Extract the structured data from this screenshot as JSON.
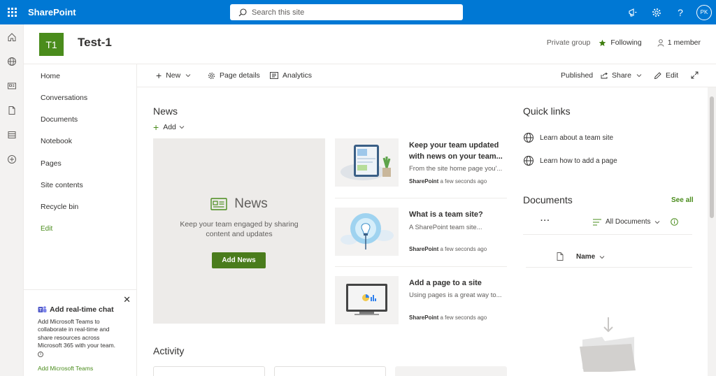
{
  "suite": {
    "app_name": "SharePoint",
    "search_placeholder": "Search this site",
    "avatar_initials": "PK"
  },
  "site": {
    "logo_text": "T1",
    "title": "Test-1",
    "privacy": "Private group",
    "following": "Following",
    "members": "1 member"
  },
  "nav": {
    "items": [
      "Home",
      "Conversations",
      "Documents",
      "Notebook",
      "Pages",
      "Site contents",
      "Recycle bin"
    ],
    "edit": "Edit"
  },
  "teams_card": {
    "title": "Add real-time chat",
    "description": "Add Microsoft Teams to collaborate in real-time and share resources across Microsoft 365 with your team.",
    "link": "Add Microsoft Teams"
  },
  "command_bar": {
    "new": "New",
    "page_details": "Page details",
    "analytics": "Analytics",
    "status": "Published",
    "share": "Share",
    "edit": "Edit"
  },
  "news": {
    "title": "News",
    "add": "Add",
    "hero_title": "News",
    "hero_desc": "Keep your team engaged by sharing content and updates",
    "hero_button": "Add News",
    "items": [
      {
        "title": "Keep your team updated with news on your team...",
        "desc": "From the site home page you'...",
        "source": "SharePoint",
        "time": "a few seconds ago"
      },
      {
        "title": "What is a team site?",
        "desc": "A SharePoint team site...",
        "source": "SharePoint",
        "time": "a few seconds ago"
      },
      {
        "title": "Add a page to a site",
        "desc": "Using pages is a great way to...",
        "source": "SharePoint",
        "time": "a few seconds ago"
      }
    ]
  },
  "activity": {
    "title": "Activity"
  },
  "quick_links": {
    "title": "Quick links",
    "items": [
      "Learn about a team site",
      "Learn how to add a page"
    ]
  },
  "documents": {
    "title": "Documents",
    "see_all": "See all",
    "more": "···",
    "view": "All Documents",
    "column_name": "Name"
  },
  "colors": {
    "suite_blue": "#0078d4",
    "theme_green": "#4a8c1c",
    "button_green": "#4a7c1c"
  }
}
